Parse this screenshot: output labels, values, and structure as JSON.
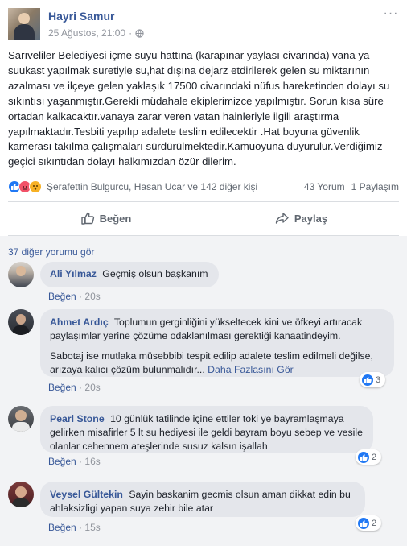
{
  "post": {
    "author": "Hayri Samur",
    "date": "25 Ağustos, 21:00",
    "separator": "·",
    "more": "···",
    "text": "Sarıveliler Belediyesi içme suyu hattına (karapınar yaylası civarında) vana ya suukast yapılmak suretiyle su,hat dışına dejarz etdirilerek gelen su miktarının azalması ve ilçeye gelen yaklaşık 17500 civarındaki nüfus hareketinden dolayı su sıkıntısı yaşanmıştır.Gerekli müdahale ekiplerimizce yapılmıştır. Sorun kısa süre ortadan kalkacaktır.vanaya zarar veren vatan hainleriyle ilgili araştırma yapılmaktadır.Tesbiti yapılıp adalete teslim edilecektir .Hat boyuna güvenlik kamerası takılma çalışmaları sürdürülmektedir.Kamuoyuna duyurulur.Verdiğimiz geçici sıkıntıdan dolayı halkımızdan özür dilerim.",
    "reactors": "Şerafettin Bulgurcu, Hasan Ucar ve 142 diğer kişi",
    "comments_count": "43 Yorum",
    "shares_count": "1 Paylaşım",
    "like_label": "Beğen",
    "share_label": "Paylaş",
    "reaction_colors": {
      "like": "#2078f4",
      "angry": "#f25268",
      "wow": "#f7b125"
    }
  },
  "comments_section": {
    "more_comments": "37 diğer yorumu gör",
    "like_label": "Beğen",
    "separator": "·",
    "items": [
      {
        "author": "Ali Yılmaz",
        "text": "Geçmiş olsun başkanım",
        "time": "20s"
      },
      {
        "author": "Ahmet Ardıç",
        "text": "Toplumun gerginliğini yükseltecek kini ve öfkeyi artıracak paylaşımlar yerine çözüme odaklanılması gerektiği kanaatindeyim.",
        "text2": "Sabotaj ise mutlaka müsebbibi tespit edilip adalete teslim edilmeli değilse, arızaya kalıcı çözüm bulunmalıdır...",
        "see_more": "Daha Fazlasını Gör",
        "time": "20s",
        "likes": "3"
      },
      {
        "author": "Pearl Stone",
        "text": "10 günlük tatilinde içine ettiler toki ye bayramlaşmaya gelirken misafirler 5 lt su hediyesi ile geldi bayram boyu sebep ve vesile olanlar cehennem ateşlerinde susuz kalsın işallah",
        "time": "16s",
        "likes": "2"
      },
      {
        "author": "Veysel Gültekin",
        "text": "Sayin baskanim gecmis olsun aman dikkat edin bu ahlaksizligi yapan suya zehir bile atar",
        "time": "15s",
        "likes": "2"
      }
    ]
  }
}
